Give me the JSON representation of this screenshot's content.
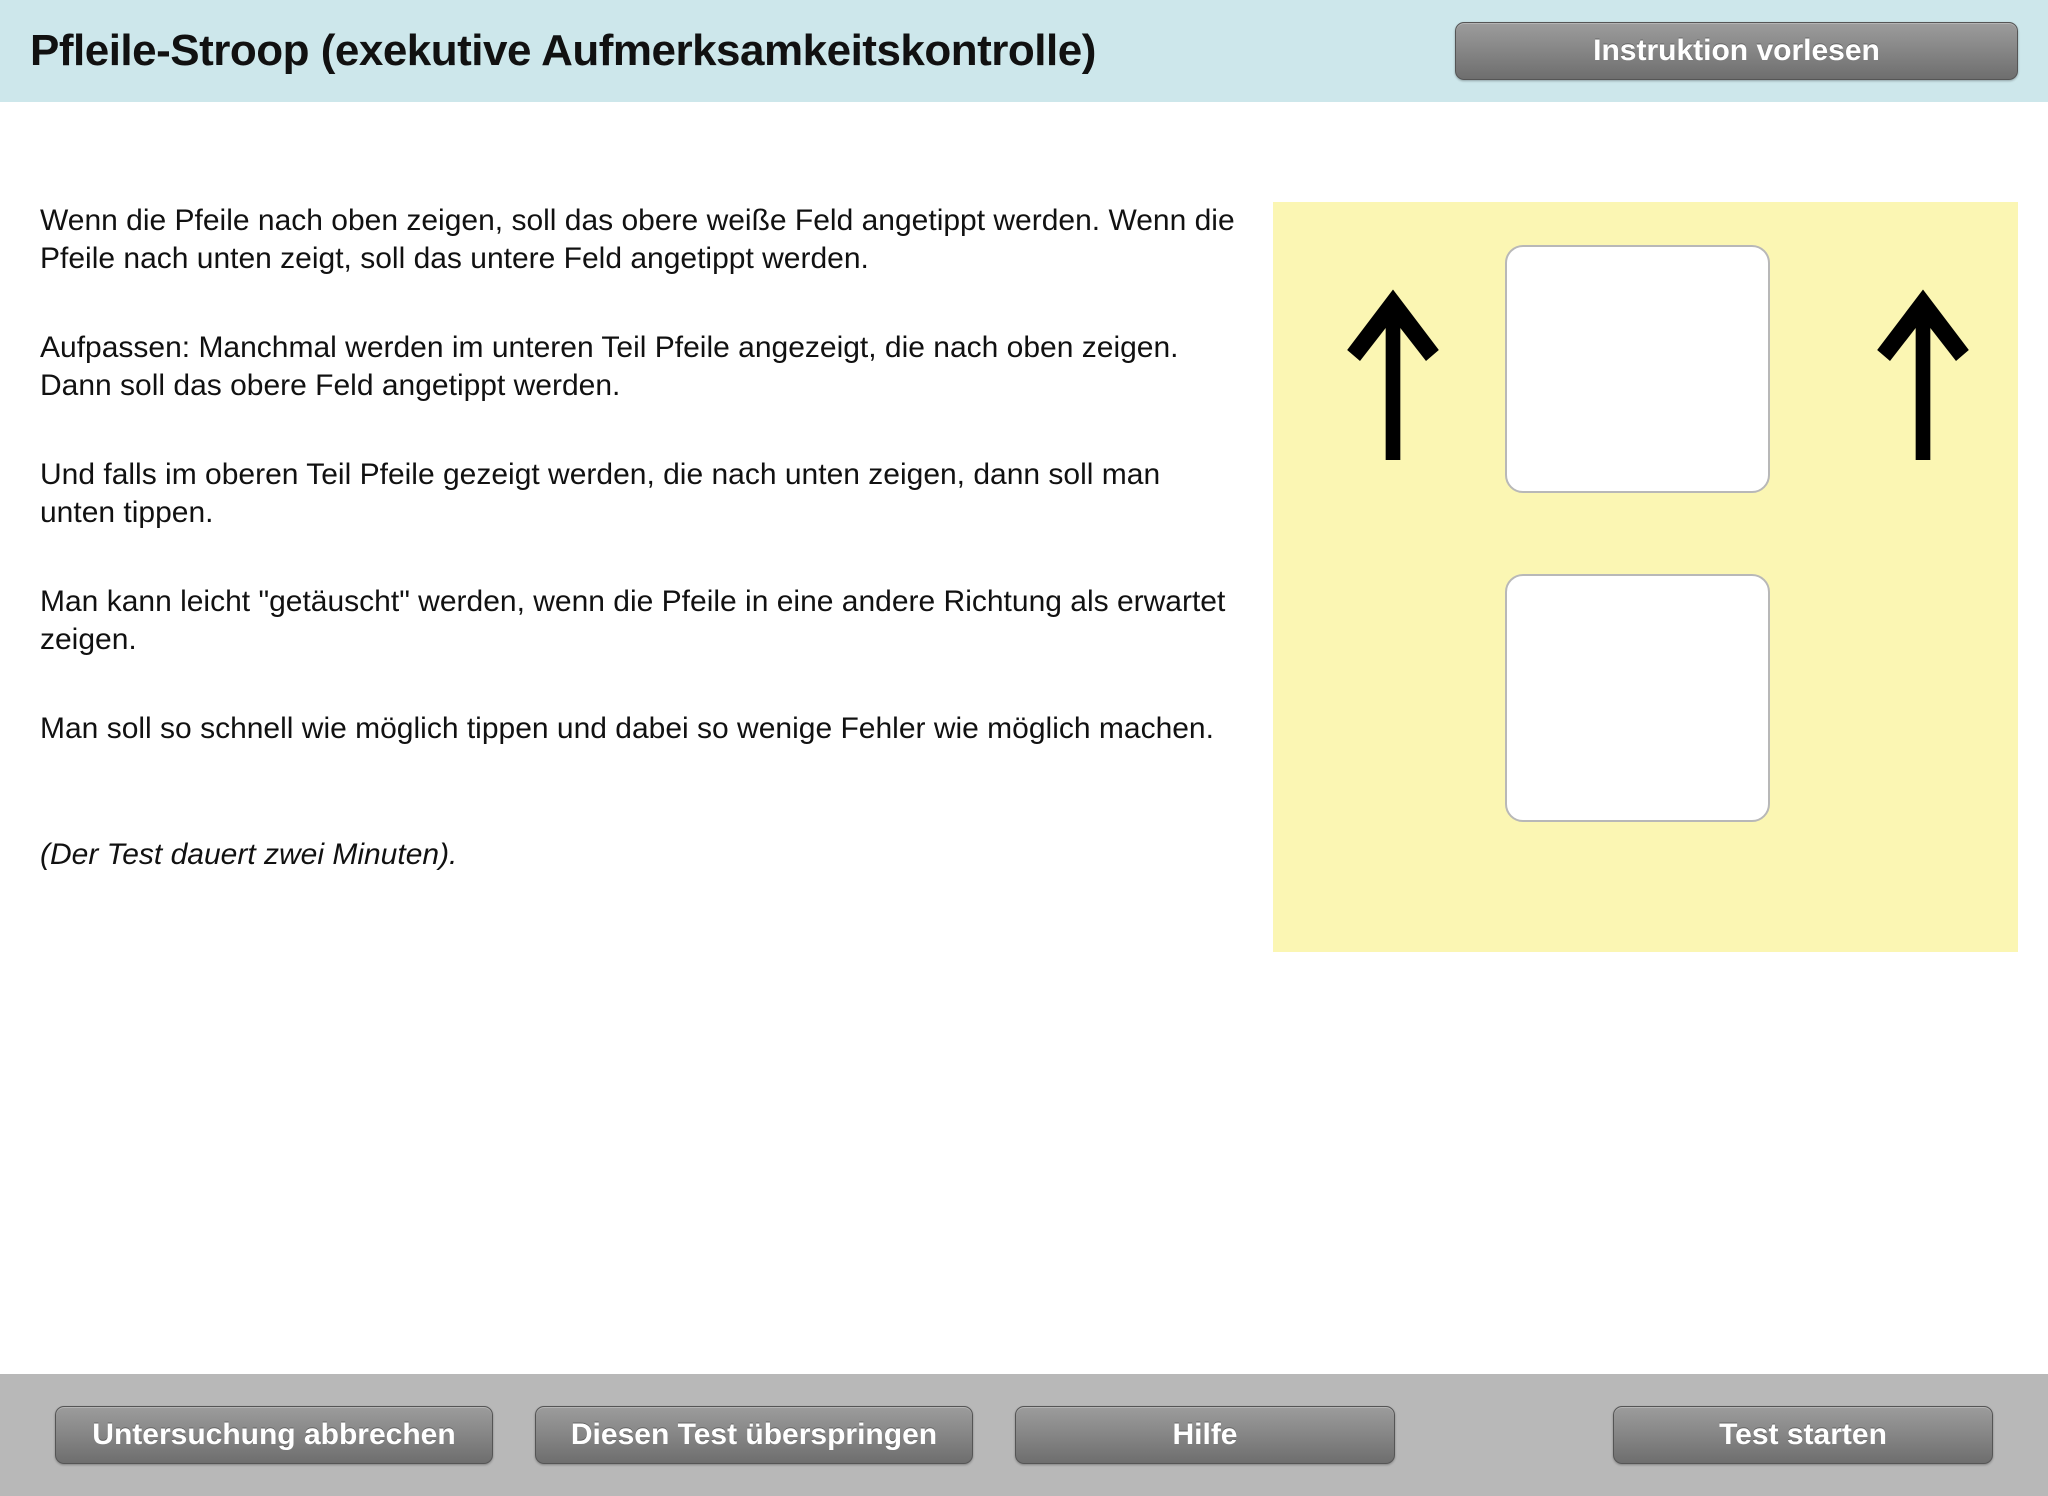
{
  "header": {
    "title": "Pfleile-Stroop (exekutive Aufmerksamkeitskontrolle)",
    "read_aloud_label": "Instruktion vorlesen"
  },
  "instructions": {
    "p1": "Wenn die Pfeile nach oben zeigen, soll das obere weiße Feld angetippt werden. Wenn die Pfeile nach unten zeigt, soll das untere Feld angetippt werden.",
    "p2": "Aufpassen: Manchmal werden im unteren Teil Pfeile angezeigt, die nach oben zeigen. Dann soll das obere Feld angetippt werden.",
    "p3": "Und falls im oberen Teil Pfeile gezeigt werden, die nach unten zeigen, dann soll man unten tippen.",
    "p4": "Man kann leicht \"getäuscht\" werden, wenn die Pfeile in eine andere Richtung als erwartet zeigen.",
    "p5": "Man soll so schnell wie möglich tippen und dabei so wenige Fehler wie möglich machen.",
    "duration": "(Der Test dauert zwei Minuten)."
  },
  "demo": {
    "arrow_direction": "up"
  },
  "footer": {
    "abort_label": "Untersuchung abbrechen",
    "skip_label": "Diesen Test überspringen",
    "help_label": "Hilfe",
    "start_label": "Test starten"
  },
  "colors": {
    "header_bg": "#cde7eb",
    "demo_bg": "#fbf6b3",
    "footer_bg": "#b8b8b8",
    "button_grad_top": "#9c9c9c",
    "button_grad_bottom": "#6e6e6e"
  }
}
